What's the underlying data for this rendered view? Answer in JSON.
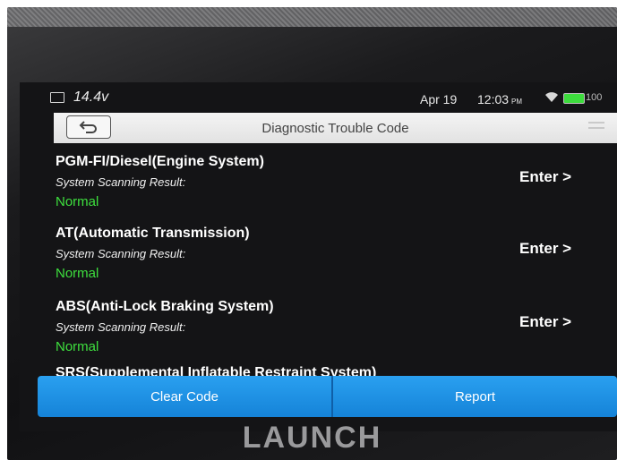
{
  "status_bar": {
    "voltage": "14.4v",
    "date": "Apr 19",
    "time": "12:03",
    "time_suffix": "PM",
    "battery_pct": "100"
  },
  "titlebar": {
    "title": "Diagnostic Trouble Code",
    "back_icon": "back-arrow-icon"
  },
  "systems": [
    {
      "name": "PGM-FI/Diesel(Engine System)",
      "result_label": "System Scanning Result:",
      "result": "Normal",
      "enter_label": "Enter >"
    },
    {
      "name": "AT(Automatic Transmission)",
      "result_label": "System Scanning Result:",
      "result": "Normal",
      "enter_label": "Enter >"
    },
    {
      "name": "ABS(Anti-Lock Braking System)",
      "result_label": "System Scanning Result:",
      "result": "Normal",
      "enter_label": "Enter >"
    },
    {
      "name": "SRS(Supplemental Inflatable Restraint System)"
    }
  ],
  "buttons": {
    "clear_code": "Clear Code",
    "report": "Report"
  },
  "brand": "LAUNCH",
  "colors": {
    "accent_blue": "#1a8fe3",
    "normal_green": "#3ee03e",
    "screen_bg": "#141416"
  }
}
